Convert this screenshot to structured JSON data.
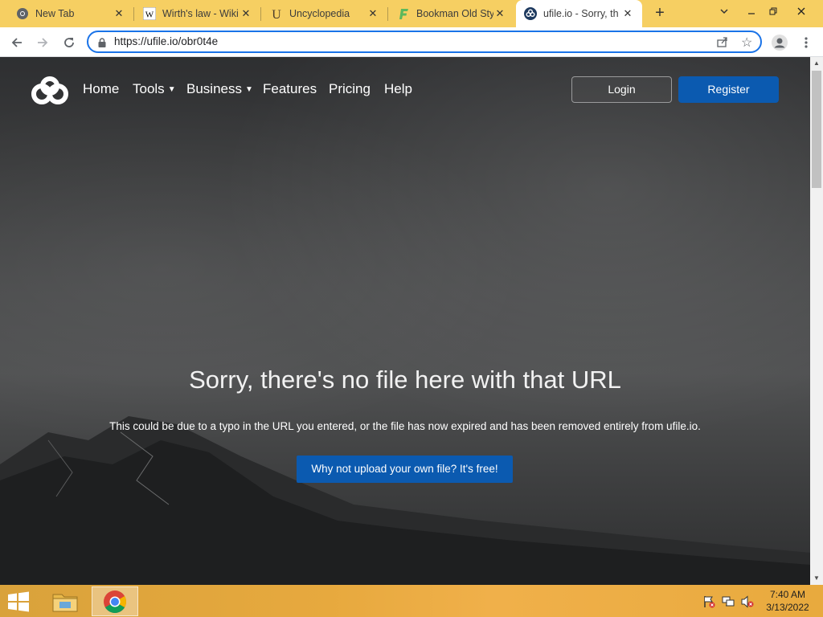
{
  "browser": {
    "tabs": [
      {
        "title": "New Tab",
        "icon": "chrome-icon"
      },
      {
        "title": "Wirth's law - Wiki",
        "icon": "wikipedia-icon"
      },
      {
        "title": "Uncyclopedia",
        "icon": "uncyclopedia-icon"
      },
      {
        "title": "Bookman Old Style",
        "icon": "fontsgeek-icon"
      },
      {
        "title": "ufile.io - Sorry, th",
        "icon": "ufile-icon",
        "active": true
      }
    ],
    "new_tab": "+",
    "url": "https://ufile.io/obr0t4e"
  },
  "site": {
    "nav": {
      "home": "Home",
      "tools": "Tools",
      "business": "Business",
      "features": "Features",
      "pricing": "Pricing",
      "help": "Help",
      "login": "Login",
      "register": "Register"
    },
    "headline": "Sorry, there's no file here with that URL",
    "subline": "This could be due to a typo in the URL you entered, or the file has now expired and has been removed entirely from ufile.io.",
    "cta": "Why not upload your own file? It's free!",
    "colors": {
      "primary_button": "#0b5ab0",
      "accent": "#1a73e8",
      "taskbar": "#e7a93e"
    }
  },
  "taskbar": {
    "time": "7:40 AM",
    "date": "3/13/2022"
  }
}
